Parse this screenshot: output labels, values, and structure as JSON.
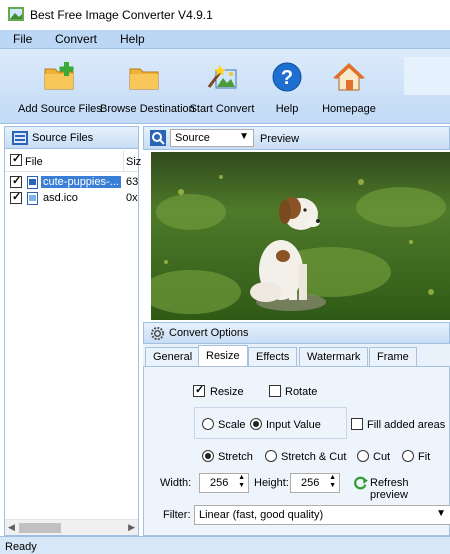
{
  "window": {
    "title": "Best Free Image Converter V4.9.1"
  },
  "menu": {
    "file": "File",
    "convert": "Convert",
    "help": "Help"
  },
  "toolbar": {
    "add_source": "Add Source Files",
    "browse_destination": "Browse Destination",
    "start_convert": "Start Convert",
    "help": "Help",
    "homepage": "Homepage"
  },
  "source_files": {
    "title": "Source Files",
    "col_file": "File",
    "col_size": "Siz",
    "rows": [
      {
        "name": "cute-puppies-...",
        "size": "63",
        "checked": true,
        "selected": true
      },
      {
        "name": "asd.ico",
        "size": "0x",
        "checked": true,
        "selected": false
      }
    ]
  },
  "preview": {
    "select_value": "Source",
    "label": "Preview"
  },
  "convert_options": {
    "title": "Convert Options",
    "tabs": [
      "General",
      "Resize",
      "Effects",
      "Watermark",
      "Frame"
    ],
    "active_tab": "Resize",
    "resize_label": "Resize",
    "rotate_label": "Rotate",
    "scale_label": "Scale",
    "input_value_label": "Input Value",
    "fill_label": "Fill added areas",
    "stretch_label": "Stretch",
    "stretch_cut_label": "Stretch & Cut",
    "cut_label": "Cut",
    "fit_label": "Fit",
    "width_label": "Width:",
    "width_value": "256",
    "height_label": "Height:",
    "height_value": "256",
    "refresh_label": "Refresh preview",
    "filter_label": "Filter:",
    "filter_value": "Linear (fast, good quality)"
  },
  "status": {
    "text": "Ready"
  },
  "icons": [
    "app-icon",
    "add-folder-icon",
    "browse-folder-icon",
    "magic-wand-icon",
    "help-icon",
    "home-icon",
    "source-files-icon",
    "zoom-icon",
    "gear-icon",
    "refresh-icon"
  ]
}
